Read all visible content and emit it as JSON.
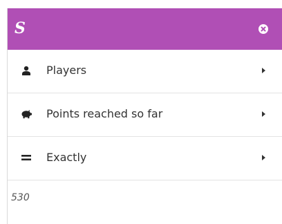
{
  "colors": {
    "accent": "#b04fb5",
    "text": "#333333"
  },
  "header": {
    "logo_text": "S",
    "logo_icon": "brand-logo",
    "close_icon": "close-circle-icon"
  },
  "menu": {
    "items": [
      {
        "label": "Players",
        "icon": "user-icon"
      },
      {
        "label": "Points reached so far",
        "icon": "piggy-bank-icon"
      },
      {
        "label": "Exactly",
        "icon": "equals-icon"
      }
    ]
  },
  "input": {
    "value": "530"
  }
}
